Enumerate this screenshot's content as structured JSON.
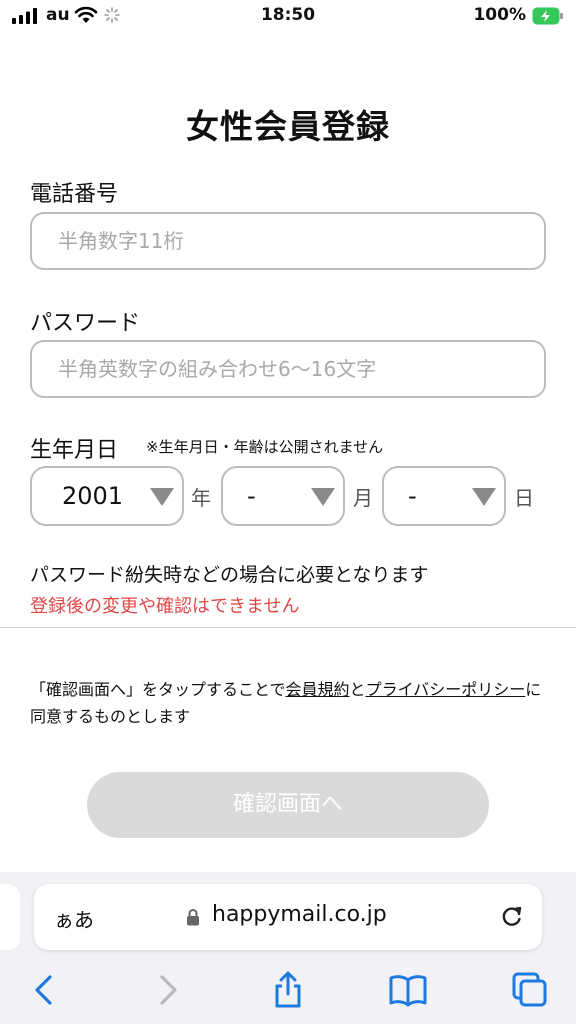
{
  "status": {
    "carrier": "au",
    "time": "18:50",
    "battery": "100%"
  },
  "page": {
    "title": "女性会員登録"
  },
  "form": {
    "phone": {
      "label": "電話番号",
      "placeholder": "半角数字11桁"
    },
    "password": {
      "label": "パスワード",
      "placeholder": "半角英数字の組み合わせ6〜16文字"
    },
    "dob": {
      "label": "生年月日",
      "note": "※生年月日・年齢は公開されません",
      "year_value": "2001",
      "year_unit": "年",
      "month_value": "-",
      "month_unit": "月",
      "day_value": "-",
      "day_unit": "日"
    },
    "info": "パスワード紛失時などの場合に必要となります",
    "warning": "登録後の変更や確認はできません"
  },
  "terms": {
    "prefix": "「確認画面へ」をタップすることで",
    "link_terms": "会員規約",
    "and": "と",
    "link_privacy": "プライバシーポリシー",
    "suffix": "に同意するものとします"
  },
  "button": {
    "confirm": "確認画面へ"
  },
  "browser": {
    "aa": "ぁあ",
    "domain": "happymail.co.jp"
  },
  "colors": {
    "warning": "#e04848",
    "battery": "#34c759",
    "ios_blue": "#1f7ae0"
  }
}
